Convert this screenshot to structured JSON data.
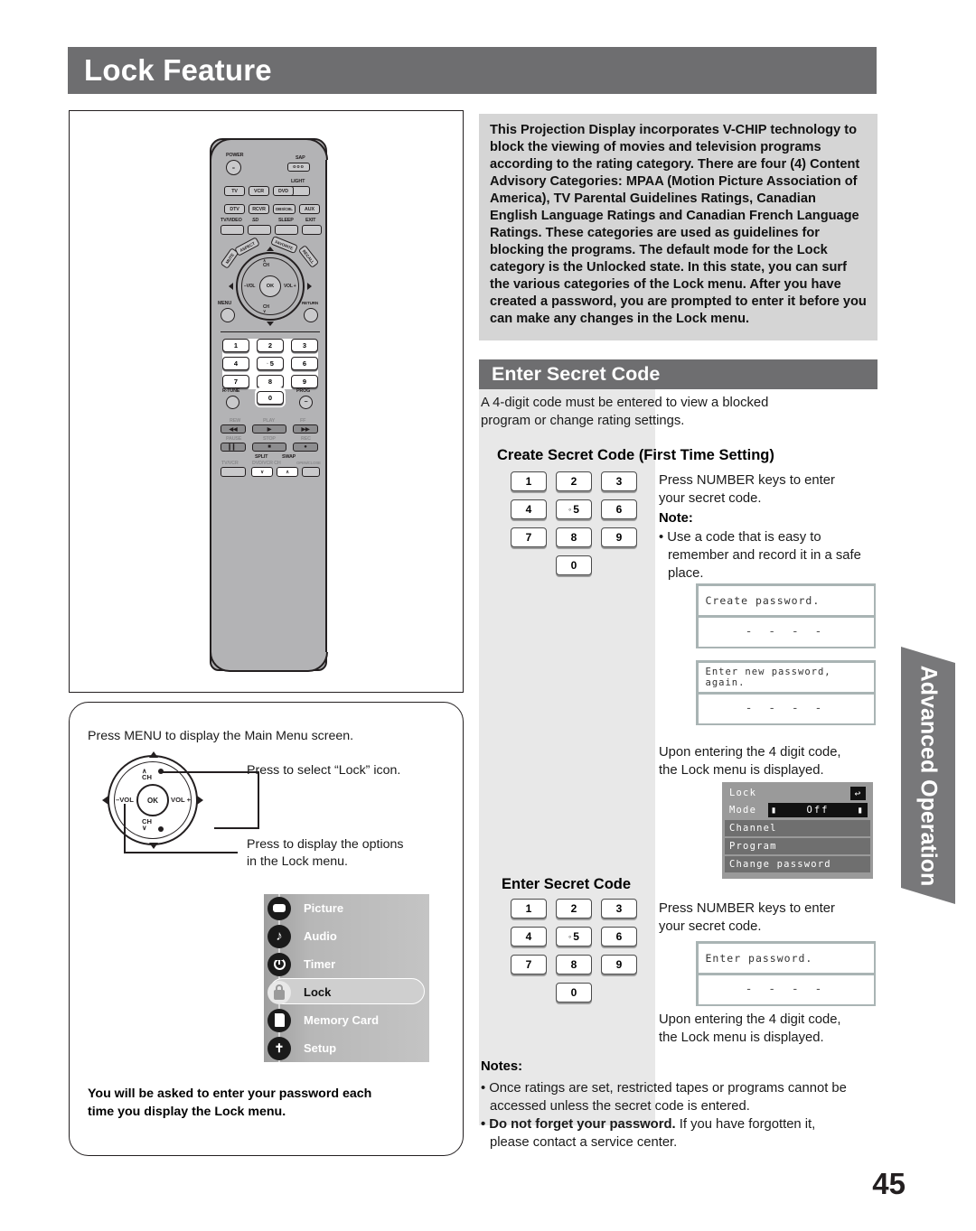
{
  "page": {
    "title": "Lock Feature",
    "number": "45",
    "side_tab": "Advanced Operation"
  },
  "vchip": {
    "paragraph": "This Projection Display incorporates V-CHIP technology to block the viewing of movies and television programs according to the rating category. There are four (4) Content Advisory Categories: MPAA (Motion Picture Association of America), TV Parental Guidelines Ratings, Canadian English Language Ratings and Canadian French Language Ratings. These categories are used as guidelines for blocking the programs. The default mode for the Lock category is the Unlocked state. In this state, you can surf the various categories of the Lock menu. After you have created a password, you are prompted to enter it before you can make any changes in the Lock menu."
  },
  "remote": {
    "power": "POWER",
    "sap": "SAP",
    "light": "LIGHT",
    "devices_row1": [
      "TV",
      "VCR",
      "DVD"
    ],
    "devices_row2": [
      "DTV",
      "RCVR",
      "DBS/CBL",
      "AUX"
    ],
    "row3_labels": [
      "TV/VIDEO",
      "SD",
      "SLEEP",
      "EXIT"
    ],
    "arc_labels": [
      "MUTE",
      "ASPECT",
      "FAVORITE",
      "RECALL"
    ],
    "nav": {
      "ch_up": "CH",
      "ch_up_caret": "∧",
      "ch_down": "CH",
      "ch_down_caret": "∨",
      "vol_minus": "–VOL",
      "vol_plus": "VOL +",
      "ok": "OK"
    },
    "menu": "MENU",
    "return": "RETURN",
    "keys": [
      "1",
      "2",
      "3",
      "4",
      "5",
      "6",
      "7",
      "8",
      "9",
      "0"
    ],
    "r_tune": "R-TUNE",
    "prog": "PROG",
    "transport": {
      "rew": "REW",
      "play": "PLAY",
      "ff": "FF",
      "pause": "PAUSE",
      "stop": "STOP",
      "rec": "REC",
      "tv_vcr": "TV/VCR",
      "split": "SPLIT",
      "swap": "SWAP",
      "dvd_vcr_ch": "DVD/VCR CH",
      "open_close": "OPEN/CLOSE",
      "ch_down_glyph": "∨",
      "ch_up_glyph": "∧"
    }
  },
  "left_panel": {
    "intro": "Press MENU to display the Main Menu screen.",
    "callout_select": "Press to select “Lock” icon.",
    "callout_options_line1": "Press to display the options",
    "callout_options_line2": "in the Lock menu.",
    "pad": {
      "ch_up_caret": "∧",
      "ch_up": "CH",
      "ch_down": "CH",
      "ch_down_caret": "∨",
      "vol_minus": "–VOL",
      "vol_plus": "VOL +",
      "ok": "OK"
    },
    "main_menu_items": [
      {
        "label": "Picture",
        "icon": "picture-icon",
        "selected": false
      },
      {
        "label": "Audio",
        "icon": "audio-note-icon",
        "selected": false
      },
      {
        "label": "Timer",
        "icon": "timer-power-icon",
        "selected": false
      },
      {
        "label": "Lock",
        "icon": "lock-padlock-icon",
        "selected": true
      },
      {
        "label": "Memory Card",
        "icon": "memory-card-icon",
        "selected": false
      },
      {
        "label": "Setup",
        "icon": "setup-wrench-icon",
        "selected": false
      }
    ],
    "footer_bold_line1": "You will be asked to enter your password each",
    "footer_bold_line2": "time you display the Lock menu."
  },
  "enter_secret_code": {
    "heading": "Enter Secret Code",
    "intro_line1": "A 4-digit code must be entered to view a blocked",
    "intro_line2": "program or change rating settings.",
    "create": {
      "sub_heading": "Create Secret Code (First Time Setting)",
      "keys": [
        "1",
        "2",
        "3",
        "4",
        "5",
        "6",
        "7",
        "8",
        "9",
        "0"
      ],
      "instruction_line1": "Press NUMBER keys to enter",
      "instruction_line2": "your secret code.",
      "note_label": "Note:",
      "note_line1": "• Use a code that is easy to",
      "note_line2": "remember and record it in a safe",
      "note_line3": "place.",
      "dialog1": {
        "prompt": "Create password.",
        "dashes": "- - - -"
      },
      "dialog2": {
        "prompt": "Enter new password, again.",
        "dashes": "- - - -"
      },
      "after_line1": "Upon entering the 4 digit code,",
      "after_line2": "the Lock menu is displayed."
    },
    "lock_menu_osd": {
      "title": "Lock",
      "back_icon": "↩",
      "mode_label": "Mode",
      "mode_value": "Off",
      "mode_left_arrow": "▮",
      "mode_right_arrow": "▮",
      "items": [
        "Channel",
        "Program",
        "Change password"
      ]
    },
    "enter": {
      "sub_heading": "Enter Secret Code",
      "keys": [
        "1",
        "2",
        "3",
        "4",
        "5",
        "6",
        "7",
        "8",
        "9",
        "0"
      ],
      "instruction_line1": "Press NUMBER keys to enter",
      "instruction_line2": "your secret code.",
      "dialog": {
        "prompt": "Enter password.",
        "dashes": "- - - -"
      },
      "after_line1": "Upon entering the 4 digit code,",
      "after_line2": "the Lock menu is displayed."
    },
    "notes": {
      "label": "Notes:",
      "note1_line1": "• Once ratings are set, restricted tapes or programs cannot be",
      "note1_line2": "accessed unless the secret code is entered.",
      "note2_bold": "• Do not forget your password.",
      "note2_rest": " If you have forgotten it,",
      "note2_line2": "please contact a service center."
    }
  },
  "colors": {
    "header_gray": "#6e6e70",
    "panel_gray": "#d5d5d5",
    "column_gray": "#e8e8e8",
    "ink": "#231f20"
  }
}
